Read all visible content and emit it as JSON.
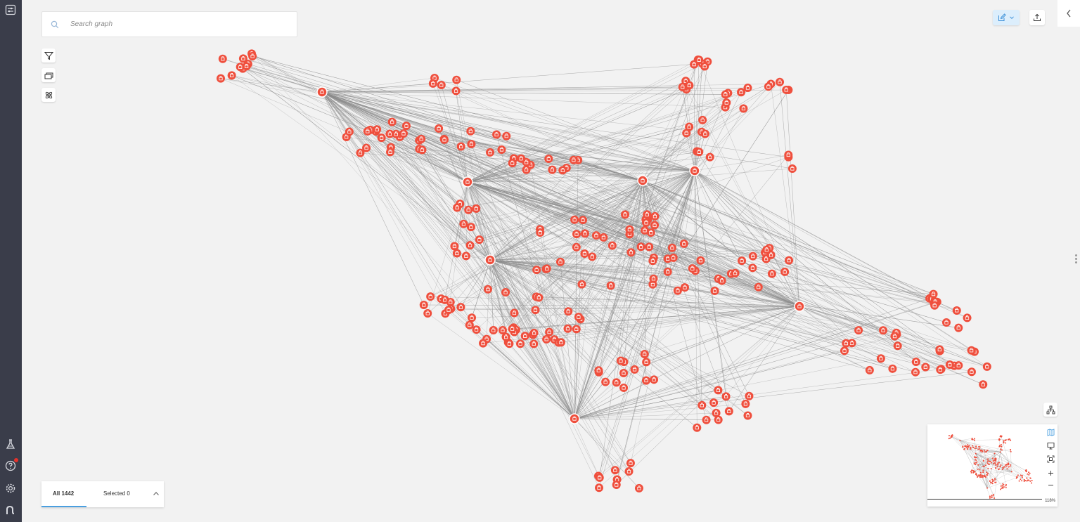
{
  "search": {
    "placeholder": "Search graph"
  },
  "tabs": {
    "all_label": "All 1442",
    "selected_label": "Selected 0"
  },
  "minimap": {
    "zoom_label": "118%"
  },
  "colors": {
    "node": "#ef4f3d",
    "edge": "#8c8c8c",
    "rail": "#3a3d4a",
    "accent": "#4a9fe0",
    "background": "#f2f2f2"
  },
  "icons": {
    "rail": [
      "settings-panel-icon",
      "lab-flask-icon",
      "help-icon",
      "gear-icon",
      "brand-logo-icon"
    ],
    "tools": [
      "filter-icon",
      "layers-icon",
      "layout-atom-icon"
    ],
    "top": [
      "edit-icon",
      "chevron-down-icon",
      "export-upload-icon",
      "chevron-left-icon"
    ],
    "minimap": [
      "map-icon",
      "presentation-icon",
      "fit-screen-icon",
      "zoom-in-icon",
      "zoom-out-icon",
      "hierarchy-icon"
    ],
    "node": "person-icon"
  }
}
